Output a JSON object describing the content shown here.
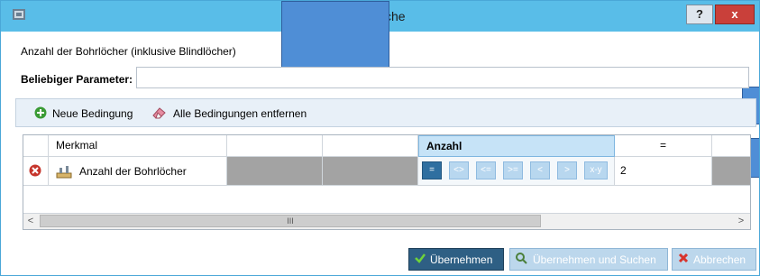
{
  "window": {
    "title_visible": "giesuche",
    "help_label": "?",
    "close_label": "x"
  },
  "form": {
    "description": "Anzahl der Bohrlöcher (inklusive Blindlöcher)",
    "param_label": "Beliebiger Parameter:",
    "param_value": ""
  },
  "toolbar": {
    "new_condition": "Neue Bedingung",
    "remove_all": "Alle Bedingungen entfernen"
  },
  "grid": {
    "headers": [
      "Merkmal",
      "",
      "",
      "Anzahl",
      "="
    ],
    "row": {
      "feature": "Anzahl der Bohrlöcher",
      "operators": [
        "=",
        "<>",
        "<=",
        ">=",
        "<",
        ">",
        "x-y"
      ],
      "selected_operator": "=",
      "value": "2"
    },
    "scroll_left": "<",
    "scroll_right": ">",
    "scroll_thumb": "III"
  },
  "buttons": {
    "apply": "Übernehmen",
    "apply_search": "Übernehmen und Suchen",
    "cancel": "Abbrechen"
  },
  "colors": {
    "titlebar": "#59bde8",
    "selected_header": "#c6e3f7",
    "accent_dark": "#2f6fa0",
    "gray_cell": "#a3a3a3"
  }
}
